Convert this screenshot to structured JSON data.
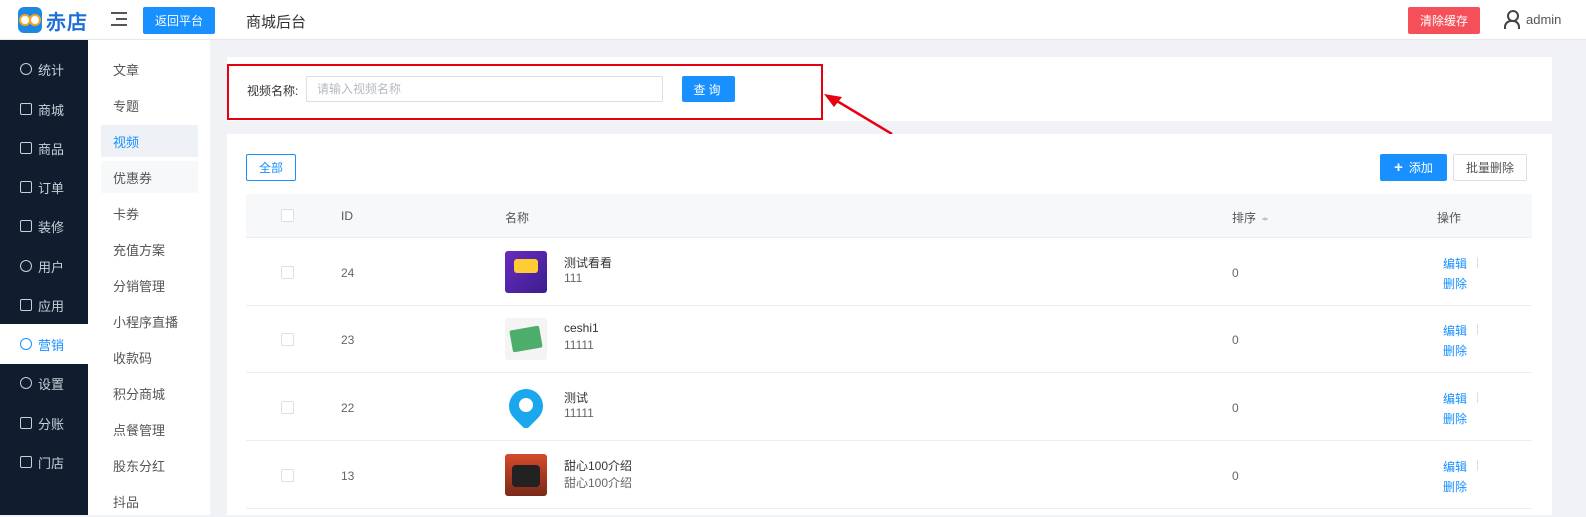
{
  "header": {
    "logo_text": "赤店",
    "back_label": "返回平台",
    "title": "商城后台",
    "clear_cache_label": "清除缓存",
    "username": "admin",
    "colors": {
      "primary": "#1890ff",
      "danger": "#f5505a",
      "sidebar": "#0f1d2e"
    }
  },
  "sidebar": {
    "items": [
      {
        "label": "统计",
        "icon": "stats-icon"
      },
      {
        "label": "商城",
        "icon": "shop-icon"
      },
      {
        "label": "商品",
        "icon": "goods-icon"
      },
      {
        "label": "订单",
        "icon": "order-icon"
      },
      {
        "label": "装修",
        "icon": "decorate-icon"
      },
      {
        "label": "用户",
        "icon": "user-icon"
      },
      {
        "label": "营销",
        "icon": "marketing-icon"
      },
      {
        "label": "设置",
        "icon": "settings-icon"
      },
      {
        "label": "分账",
        "icon": "split-icon"
      },
      {
        "label": "门店",
        "icon": "store-icon"
      }
    ],
    "active_index": 7
  },
  "submenu": {
    "items": [
      "文章",
      "专题",
      "视频",
      "优惠券",
      "卡券",
      "充值方案",
      "分销管理",
      "小程序直播",
      "收款码",
      "积分商城",
      "点餐管理",
      "股东分红",
      "抖品"
    ],
    "active": "视频"
  },
  "search": {
    "label": "视频名称:",
    "placeholder": "请输入视频名称",
    "value": "",
    "button_label": "查询"
  },
  "toolbar": {
    "tab_all": "全部",
    "add_label": "添加",
    "batch_delete_label": "批量删除"
  },
  "table": {
    "columns": {
      "id": "ID",
      "name": "名称",
      "sort": "排序",
      "ops": "操作"
    },
    "rows": [
      {
        "id": "24",
        "title": "测试看看",
        "subtitle": "111",
        "sort": "0",
        "edit": "编辑",
        "delete": "删除"
      },
      {
        "id": "23",
        "title": "ceshi1",
        "subtitle": "11111",
        "sort": "0",
        "edit": "编辑",
        "delete": "删除"
      },
      {
        "id": "22",
        "title": "测试",
        "subtitle": "11111",
        "sort": "0",
        "edit": "编辑",
        "delete": "删除"
      },
      {
        "id": "13",
        "title": "甜心100介绍",
        "subtitle": "甜心100介绍",
        "sort": "0",
        "edit": "编辑",
        "delete": "删除"
      }
    ]
  }
}
